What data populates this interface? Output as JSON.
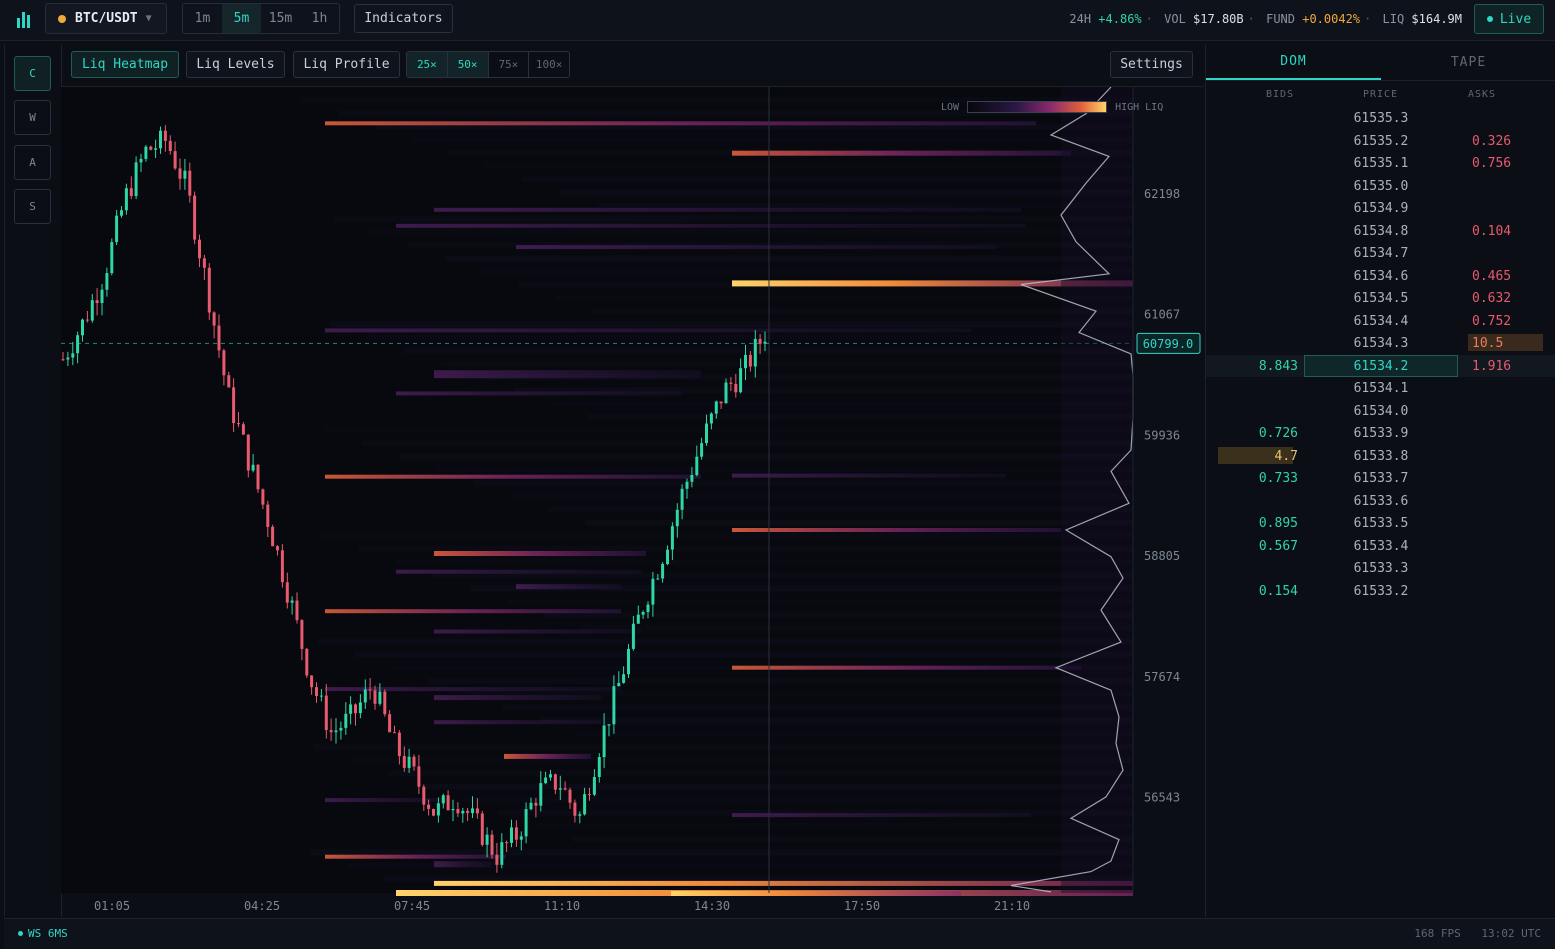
{
  "header": {
    "symbol": "BTC/USDT",
    "timeframes": [
      "1m",
      "5m",
      "15m",
      "1h"
    ],
    "active_timeframe": "5m",
    "indicators_label": "Indicators",
    "stats": {
      "change_label": "24H",
      "change_value": "+4.86%",
      "vol_label": "VOL",
      "vol_value": "$17.80B",
      "fund_label": "FUND",
      "fund_value": "+0.0042%",
      "liq_label": "LIQ",
      "liq_value": "$164.9M"
    },
    "live_label": "Live"
  },
  "rail": [
    "C",
    "W",
    "A",
    "S"
  ],
  "tools": {
    "modes": [
      "Liq Heatmap",
      "Liq Levels",
      "Liq Profile"
    ],
    "active_mode": "Liq Heatmap",
    "zooms": [
      "25×",
      "50×",
      "75×",
      "100×"
    ],
    "active_zooms": [
      "25×",
      "50×"
    ],
    "settings_label": "Settings"
  },
  "legend": {
    "low": "LOW",
    "high": "HIGH LIQ"
  },
  "chart_data": {
    "type": "heatmap",
    "y_ticks": [
      62198,
      61067,
      59936,
      58805,
      57674,
      56543
    ],
    "x_ticks": [
      "01:05",
      "04:25",
      "07:45",
      "11:10",
      "14:30",
      "17:50",
      "21:10"
    ],
    "current_price": "60799.0",
    "ylim": [
      55650,
      63200
    ],
    "price_path": [
      60650,
      61000,
      61450,
      62150,
      62600,
      62700,
      62250,
      61300,
      60300,
      59700,
      59100,
      58400,
      57650,
      57150,
      57300,
      57600,
      57050,
      56750,
      56400,
      56550,
      56300,
      56000,
      56200,
      56600,
      56700,
      56350,
      57050,
      57650,
      58300,
      58800,
      59400,
      59900,
      60350,
      60550,
      60900
    ]
  },
  "bottom": {
    "ws": "WS 6MS",
    "fps": "168 FPS",
    "time": "13:02 UTC"
  },
  "dom": {
    "tabs": [
      "DOM",
      "TAPE"
    ],
    "active_tab": "DOM",
    "headers": {
      "bids": "BIDS",
      "price": "PRICE",
      "asks": "ASKS"
    },
    "rows": [
      {
        "bid": "",
        "price": "61535.3",
        "ask": ""
      },
      {
        "bid": "",
        "price": "61535.2",
        "ask": "0.326"
      },
      {
        "bid": "",
        "price": "61535.1",
        "ask": "0.756"
      },
      {
        "bid": "",
        "price": "61535.0",
        "ask": ""
      },
      {
        "bid": "",
        "price": "61534.9",
        "ask": ""
      },
      {
        "bid": "",
        "price": "61534.8",
        "ask": "0.104"
      },
      {
        "bid": "",
        "price": "61534.7",
        "ask": ""
      },
      {
        "bid": "",
        "price": "61534.6",
        "ask": "0.465"
      },
      {
        "bid": "",
        "price": "61534.5",
        "ask": "0.632"
      },
      {
        "bid": "",
        "price": "61534.4",
        "ask": "0.752"
      },
      {
        "bid": "",
        "price": "61534.3",
        "ask": "10.5"
      },
      {
        "bid": "8.843",
        "price": "61534.2",
        "ask": "1.916"
      },
      {
        "bid": "",
        "price": "61534.1",
        "ask": ""
      },
      {
        "bid": "",
        "price": "61534.0",
        "ask": ""
      },
      {
        "bid": "0.726",
        "price": "61533.9",
        "ask": ""
      },
      {
        "bid": "4.7",
        "price": "61533.8",
        "ask": ""
      },
      {
        "bid": "0.733",
        "price": "61533.7",
        "ask": ""
      },
      {
        "bid": "",
        "price": "61533.6",
        "ask": ""
      },
      {
        "bid": "0.895",
        "price": "61533.5",
        "ask": ""
      },
      {
        "bid": "0.567",
        "price": "61533.4",
        "ask": ""
      },
      {
        "bid": "",
        "price": "61533.3",
        "ask": ""
      },
      {
        "bid": "0.154",
        "price": "61533.2",
        "ask": ""
      }
    ]
  },
  "colors": {
    "accent": "#2fd6c6",
    "up": "#2fd6a6",
    "down": "#e85a6e",
    "funding": "#f0a93b"
  }
}
